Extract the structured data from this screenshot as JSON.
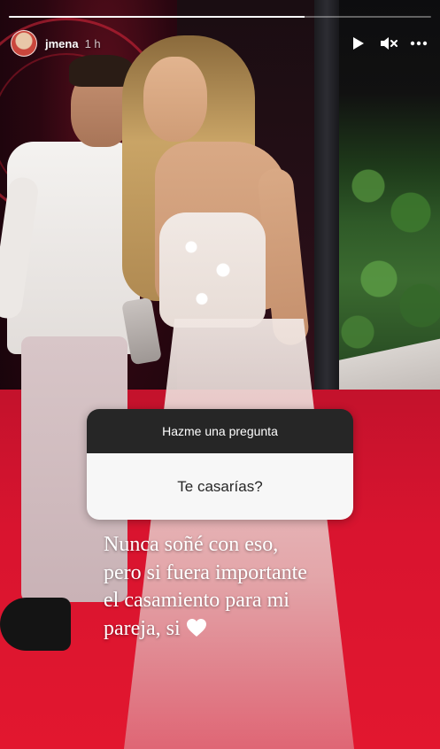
{
  "story": {
    "progress": 0.7
  },
  "header": {
    "username": "jmena",
    "timestamp": "1 h"
  },
  "icons": {
    "play": "play-icon",
    "mute": "mute-icon",
    "more": "more-icon",
    "heart": "heart-icon"
  },
  "sticker": {
    "title": "Hazme una pregunta",
    "question": "Te casarías?"
  },
  "answer": {
    "line1": "Nunca soñé con eso,",
    "line2": "pero si fuera importante",
    "line3": "el casamiento para mi",
    "line4": "pareja, si"
  },
  "colors": {
    "carpet": "#d9142f",
    "sticker_header": "#262626",
    "sticker_body": "#f7f7f7"
  }
}
